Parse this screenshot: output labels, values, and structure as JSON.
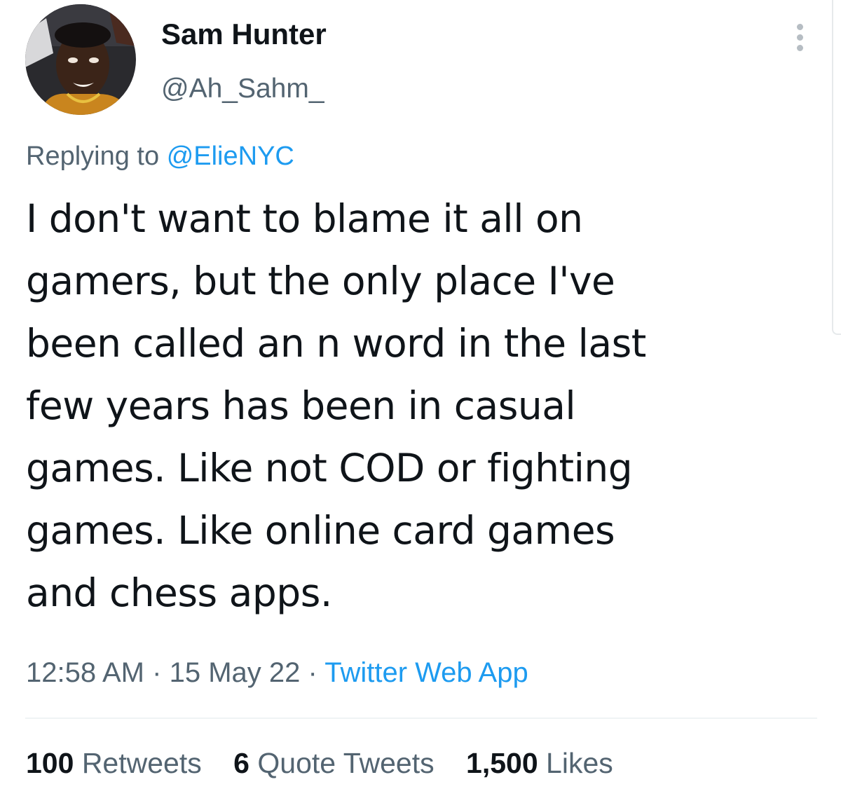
{
  "author": {
    "name": "Sam Hunter",
    "handle": "@Ah_Sahm_",
    "avatar_icon": "profile-photo"
  },
  "more_icon": "vertical-ellipsis-icon",
  "reply": {
    "prefix": "Replying to",
    "mention": "@ElieNYC"
  },
  "tweet": {
    "lines": [
      "I don't want to blame it all on",
      "gamers, but the only place I've",
      "been called an n word in the last",
      "few years has been in casual",
      "games. Like not COD or fighting",
      "games. Like online card games",
      "and chess apps."
    ]
  },
  "meta": {
    "time": "12:58 AM",
    "separator": "·",
    "date": "15 May 22",
    "source": "Twitter Web App"
  },
  "stats": {
    "retweets_count": "100",
    "retweets_label": "Retweets",
    "quotes_count": "6",
    "quotes_label": "Quote Tweets",
    "likes_count": "1,500",
    "likes_label": "Likes"
  },
  "colors": {
    "link": "#1d9bf0",
    "secondary_text": "#536471",
    "primary_text": "#0f1419",
    "divider": "#eff3f4"
  }
}
